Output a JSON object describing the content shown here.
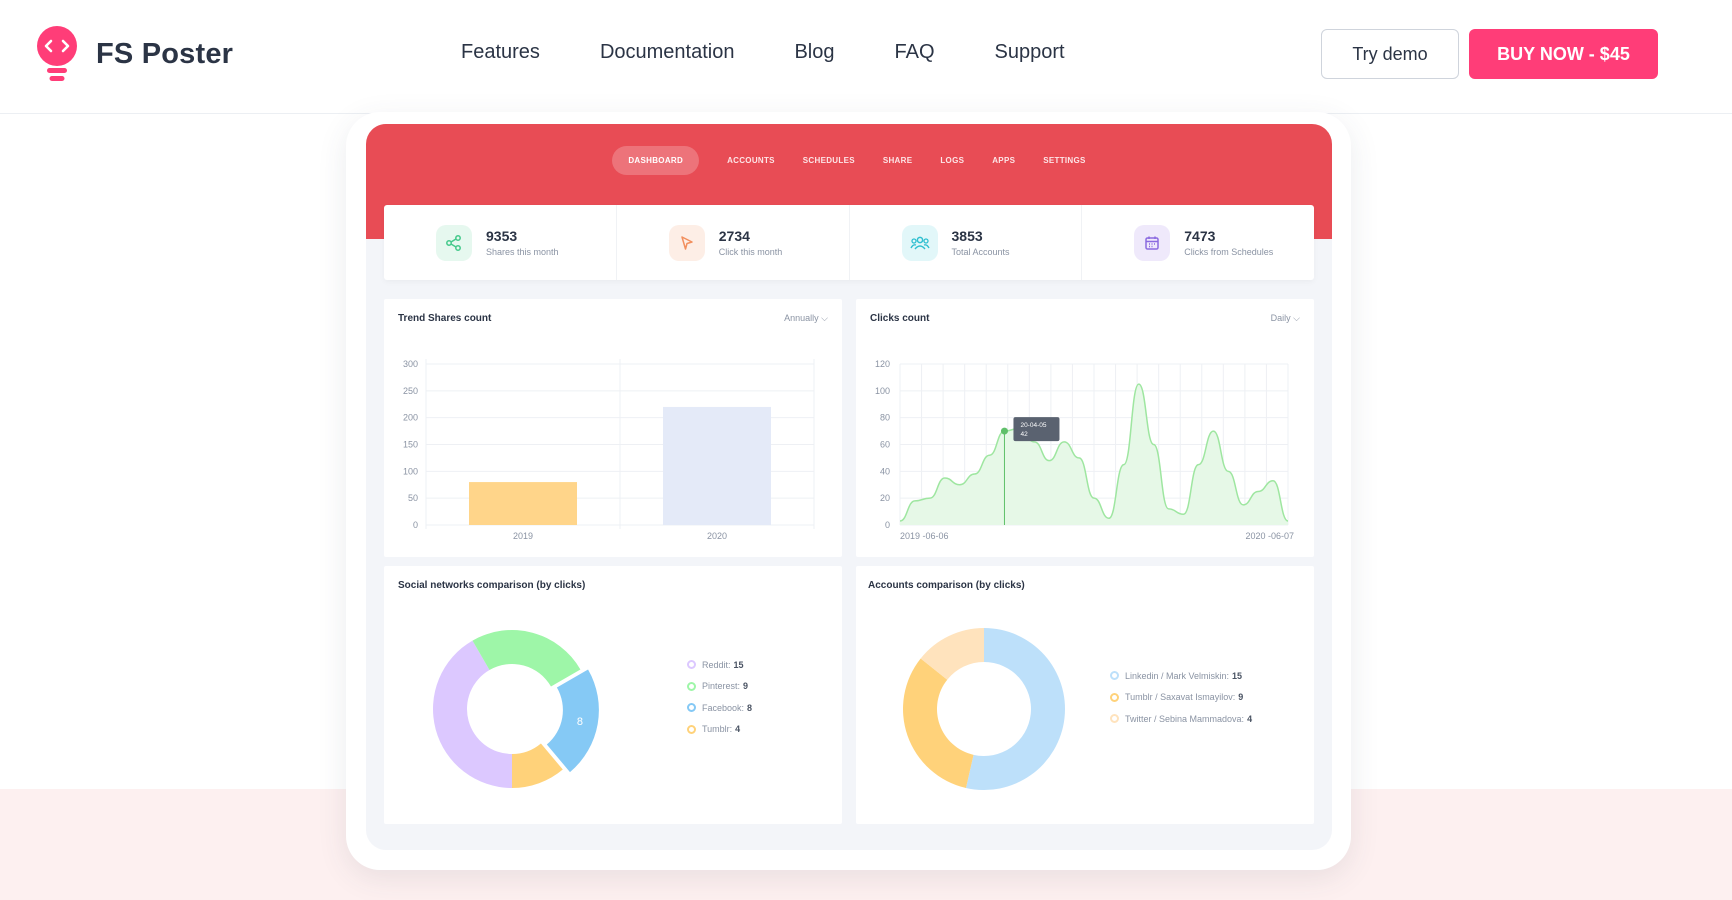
{
  "site": {
    "brand": "FS Poster",
    "nav": [
      "Features",
      "Documentation",
      "Blog",
      "FAQ",
      "Support"
    ],
    "try_demo": "Try demo",
    "buy_now": "BUY NOW - $45",
    "brand_color": "#ff3d78"
  },
  "app": {
    "nav": [
      "DASHBOARD",
      "ACCOUNTS",
      "SCHEDULES",
      "SHARE",
      "LOGS",
      "APPS",
      "SETTINGS"
    ],
    "active_tab": "DASHBOARD",
    "stats": [
      {
        "value": "9353",
        "label": "Shares this month",
        "icon": "share-icon",
        "color": "#44c98b"
      },
      {
        "value": "2734",
        "label": "Click this month",
        "icon": "cursor-icon",
        "color": "#f28f5e"
      },
      {
        "value": "3853",
        "label": "Total Accounts",
        "icon": "users-icon",
        "color": "#2fbfd0"
      },
      {
        "value": "7473",
        "label": "Clicks from Schedules",
        "icon": "calendar-icon",
        "color": "#8b6ae0"
      }
    ],
    "trend_card": {
      "title": "Trend Shares count",
      "period": "Annually"
    },
    "clicks_card": {
      "title": "Clicks count",
      "period": "Daily",
      "tooltip_date": "20-04-05",
      "tooltip_value": "42"
    },
    "social_card": {
      "title": "Social networks comparison (by clicks)"
    },
    "accounts_card": {
      "title": "Accounts comparison (by clicks)"
    }
  },
  "chart_data": [
    {
      "type": "bar",
      "title": "Trend Shares count",
      "categories": [
        "2019",
        "2020"
      ],
      "values": [
        80,
        220
      ],
      "ylim": [
        0,
        300
      ],
      "yticks": [
        0,
        50,
        100,
        150,
        200,
        250,
        300
      ],
      "colors": [
        "#ffd58a",
        "#e4eaf8"
      ],
      "grid": true
    },
    {
      "type": "area",
      "title": "Clicks count",
      "x_start_label": "2019 -06-06",
      "x_end_label": "2020 -06-07",
      "values": [
        3,
        18,
        20,
        35,
        30,
        38,
        52,
        70,
        72,
        62,
        48,
        62,
        50,
        20,
        5,
        45,
        105,
        60,
        12,
        8,
        45,
        70,
        40,
        15,
        25,
        33,
        3
      ],
      "ylim": [
        0,
        120
      ],
      "yticks": [
        0,
        20,
        40,
        60,
        80,
        100,
        120
      ],
      "color": "#9ee6a0",
      "grid": true
    },
    {
      "type": "pie",
      "title": "Social networks comparison (by clicks)",
      "labels": [
        "Reddit",
        "Pinterest",
        "Facebook",
        "Tumblr"
      ],
      "values": [
        15,
        9,
        8,
        4
      ],
      "colors": [
        "#dcc8ff",
        "#9ef6a8",
        "#85c9f5",
        "#ffd27a"
      ],
      "slice_label": "8"
    },
    {
      "type": "pie",
      "title": "Accounts comparison (by clicks)",
      "labels": [
        "Linkedin / Mark Velmiskin",
        "Tumblr / Saxavat Ismayilov",
        "Twitter / Sebina Mammadova"
      ],
      "values": [
        15,
        9,
        4
      ],
      "colors": [
        "#bde0fa",
        "#ffd27a",
        "#ffe3bd"
      ]
    }
  ]
}
